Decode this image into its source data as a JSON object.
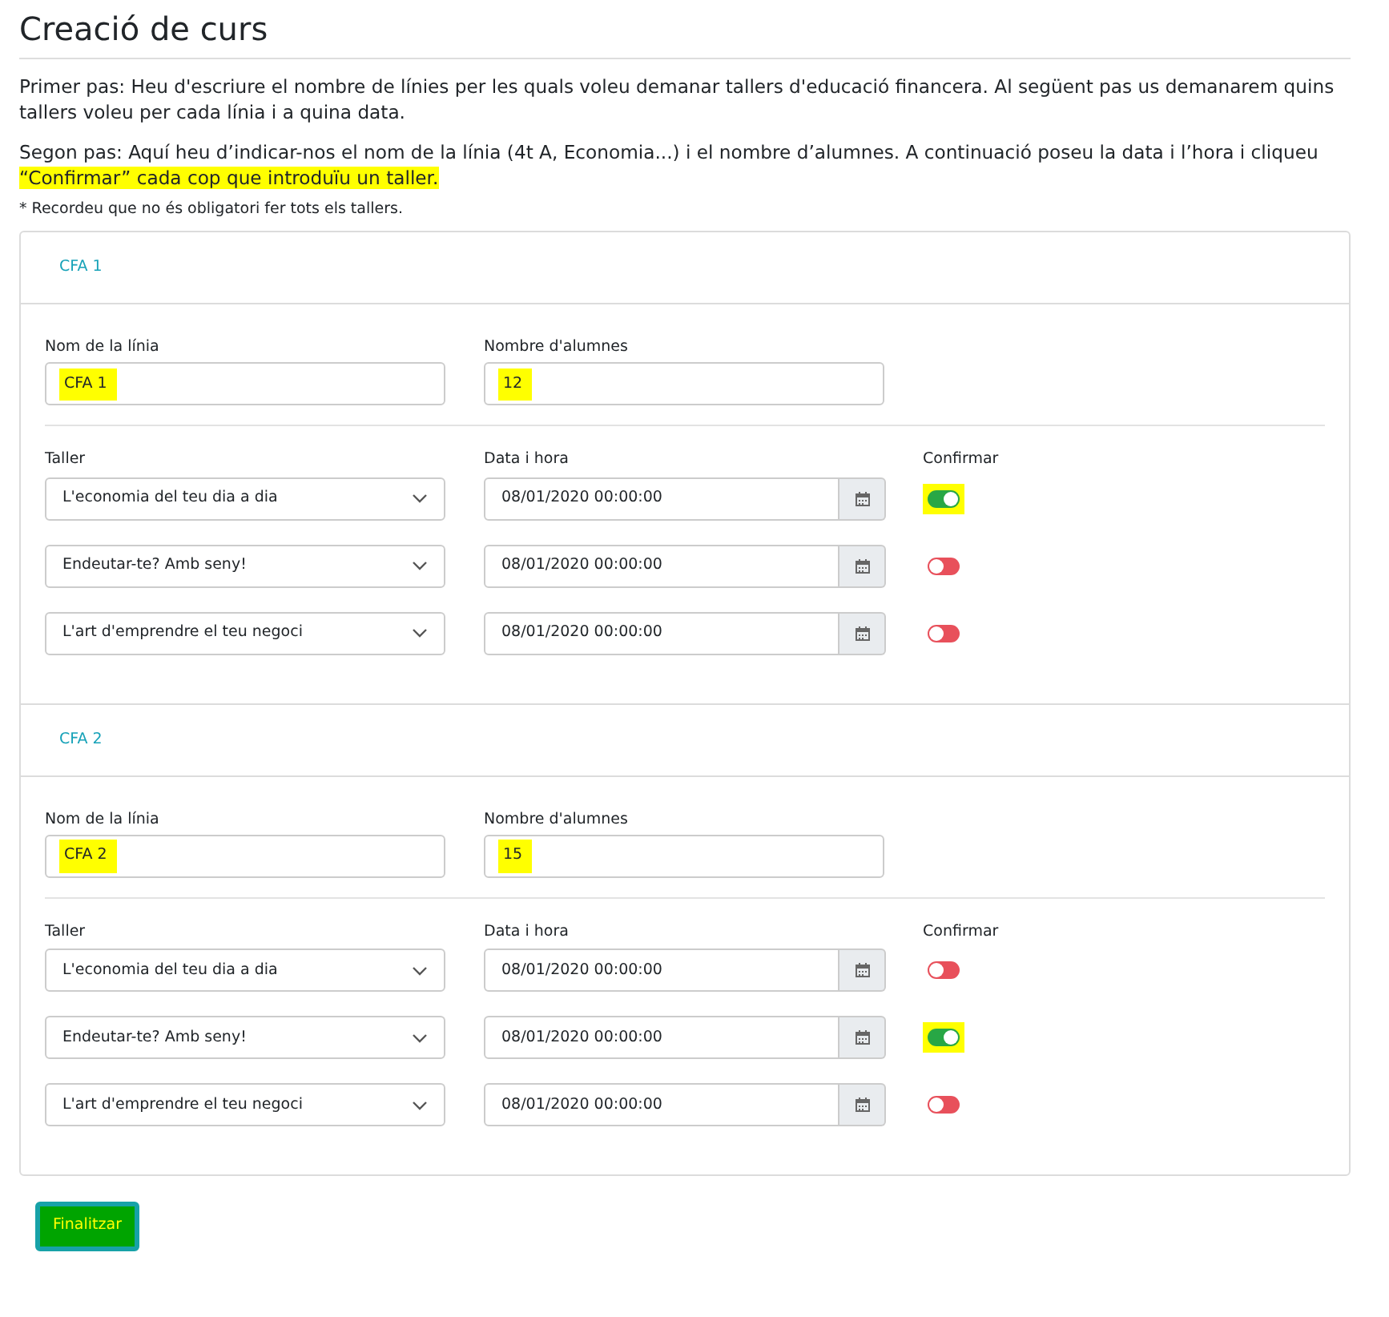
{
  "title": "Creació de curs",
  "intro": [
    {
      "text": "Primer pas: Heu d'escriure el nombre de línies per les quals voleu demanar tallers d'educació financera. Al següent pas us demanarem quins tallers voleu per cada línia i a quina data."
    },
    {
      "text": "Segon pas: Aquí heu d’indicar-nos el nom de la línia (4t A, Economia...) i el nombre d’alumnes. A continuació poseu la data i l’hora i cliqueu ",
      "highlight": "“Confirmar” cada cop que introduïu un taller."
    }
  ],
  "note": "* Recordeu que no és obligatori fer tots els tallers.",
  "lines": [
    {
      "header": "CFA 1",
      "columns": {
        "name": "Nom de la línia",
        "students": "Nombre d'alumnes",
        "workshop": "Taller",
        "date": "Data i hora",
        "confirm": "Confirmar"
      },
      "name": {
        "value": "CFA 1",
        "highlighted": true
      },
      "students": {
        "value": "12",
        "highlighted": true
      },
      "workshops": [
        {
          "title": "L'economia del teu dia a dia",
          "date": "08/01/2020 00:00:00",
          "confirmed": true,
          "highlighted": true
        },
        {
          "title": "Endeutar-te? Amb seny!",
          "date": "08/01/2020 00:00:00",
          "confirmed": false,
          "highlighted": false
        },
        {
          "title": "L'art d'emprendre el teu negoci",
          "date": "08/01/2020 00:00:00",
          "confirmed": false,
          "highlighted": false
        }
      ]
    },
    {
      "header": "CFA 2",
      "columns": {
        "name": "Nom de la línia",
        "students": "Nombre d'alumnes",
        "workshop": "Taller",
        "date": "Data i hora",
        "confirm": "Confirmar"
      },
      "name": {
        "value": "CFA 2",
        "highlighted": true
      },
      "students": {
        "value": "15",
        "highlighted": true
      },
      "workshops": [
        {
          "title": "L'economia del teu dia a dia",
          "date": "08/01/2020 00:00:00",
          "confirmed": false,
          "highlighted": false
        },
        {
          "title": "Endeutar-te? Amb seny!",
          "date": "08/01/2020 00:00:00",
          "confirmed": true,
          "highlighted": true
        },
        {
          "title": "L'art d'emprendre el teu negoci",
          "date": "08/01/2020 00:00:00",
          "confirmed": false,
          "highlighted": false
        }
      ]
    }
  ],
  "finish_button": "Finalitzar"
}
